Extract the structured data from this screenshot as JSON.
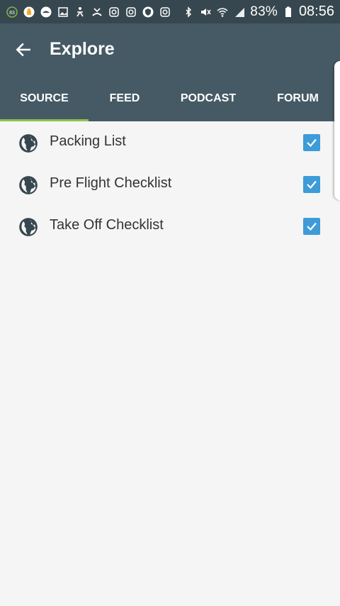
{
  "status_bar": {
    "notification_badge": "83",
    "battery_percent": "83%",
    "time": "08:56",
    "icons": [
      "badge-83-icon",
      "android-icon",
      "cloud-icon",
      "image-icon",
      "person-walk-icon",
      "missed-call-icon",
      "instagram-icon",
      "instagram-icon",
      "shield-icon",
      "instagram-icon",
      "bluetooth-icon",
      "mute-icon",
      "wifi-icon",
      "signal-icon",
      "battery-icon"
    ]
  },
  "appbar": {
    "title": "Explore",
    "back_icon": "arrow-back-icon",
    "color": "#455a64"
  },
  "tabs": [
    {
      "label": "SOURCE",
      "active": true
    },
    {
      "label": "FEED",
      "active": false
    },
    {
      "label": "PODCAST",
      "active": false
    },
    {
      "label": "FORUM",
      "active": false
    }
  ],
  "indicator_color": "#8bc34a",
  "list": [
    {
      "label": "Packing List",
      "checked": true
    },
    {
      "label": "Pre Flight Checklist",
      "checked": true
    },
    {
      "label": "Take Off Checklist",
      "checked": true
    }
  ],
  "checkbox_color": "#3d9bd8"
}
